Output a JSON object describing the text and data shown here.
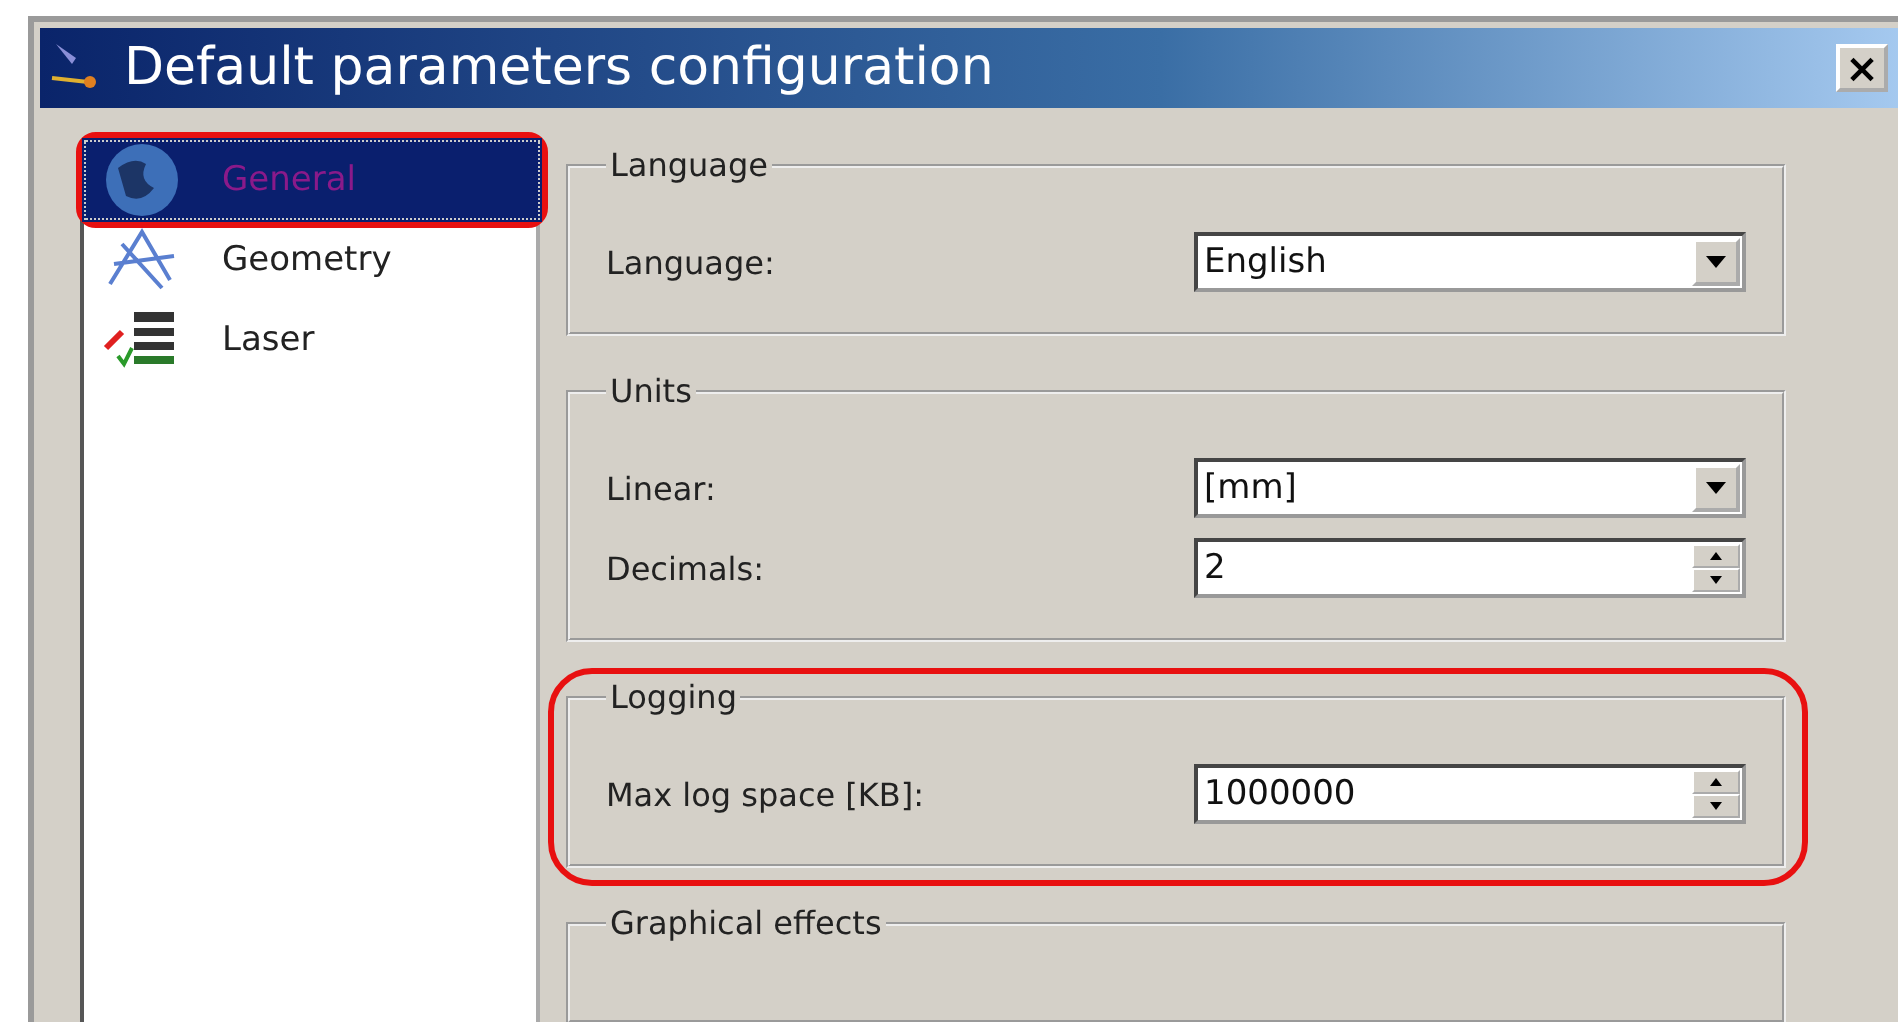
{
  "window": {
    "title": "Default parameters configuration",
    "close_label": "×"
  },
  "nav": [
    {
      "label": "General",
      "kind": "globe",
      "selected": true,
      "highlighted": true
    },
    {
      "label": "Geometry",
      "kind": "geometry",
      "selected": false,
      "highlighted": false
    },
    {
      "label": "Laser",
      "kind": "laser",
      "selected": false,
      "highlighted": false
    }
  ],
  "sections": [
    {
      "title": "Language",
      "highlighted": false,
      "rows": [
        {
          "kind": "dropdown",
          "label": "Language:",
          "value": "English"
        }
      ]
    },
    {
      "title": "Units",
      "highlighted": false,
      "rows": [
        {
          "kind": "dropdown",
          "label": "Linear:",
          "value": "[mm]"
        },
        {
          "kind": "spinner",
          "label": "Decimals:",
          "value": "2"
        }
      ]
    },
    {
      "title": "Logging",
      "highlighted": true,
      "rows": [
        {
          "kind": "spinner",
          "label": "Max log space [KB]:",
          "value": "1000000"
        }
      ]
    },
    {
      "title": "Graphical effects",
      "highlighted": false
    }
  ]
}
